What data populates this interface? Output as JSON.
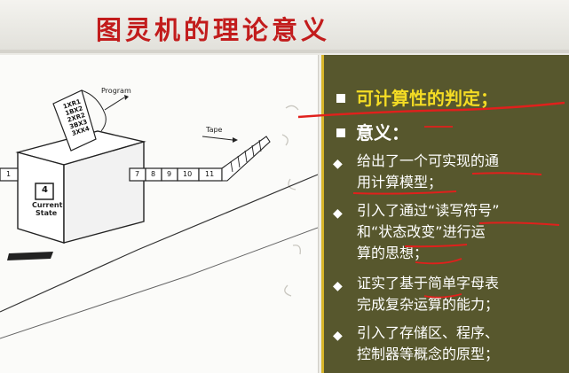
{
  "slide": {
    "title": "图灵机的理论意义"
  },
  "diagram": {
    "program_label": "Program",
    "tape_label": "Tape",
    "state_value": "4",
    "state_label_line1": "Current",
    "state_label_line2": "State",
    "program_lines": [
      "1XR1",
      "1BX2",
      "2XR2",
      "3BX3",
      "3XX4"
    ],
    "left_cell": "1",
    "tape_cells": [
      "7",
      "8",
      "9",
      "10",
      "11"
    ]
  },
  "points": [
    {
      "label": "可计算性的判定；",
      "highlight": true
    },
    {
      "label": "意义：",
      "highlight": false
    }
  ],
  "subpoints": [
    {
      "lines": [
        "给出了一个可实现的通",
        "用计算模型；"
      ]
    },
    {
      "lines": [
        "引入了通过“读写符号”",
        "和“状态改变”进行运",
        "算的思想；"
      ]
    },
    {
      "lines": [
        "证实了基于简单字母表",
        "完成复杂运算的能力；"
      ]
    },
    {
      "lines": [
        "引入了存储区、程序、",
        "控制器等概念的原型；"
      ]
    }
  ],
  "colors": {
    "title": "#c21c1c",
    "panel_bg": "#57572d",
    "highlight_text": "#f4dc24",
    "annotation_red": "#e0201c"
  }
}
